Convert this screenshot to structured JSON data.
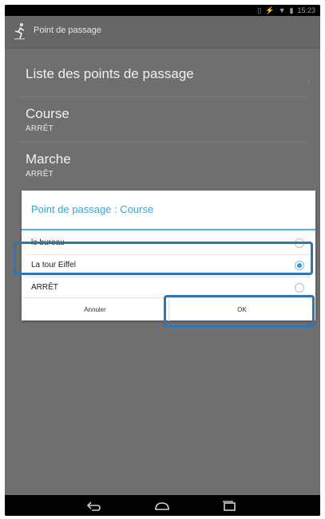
{
  "statusbar": {
    "time": "15:23",
    "icons": [
      "signal-icon",
      "wifi-icon",
      "battery-icon"
    ]
  },
  "actionbar": {
    "title": "Point de passage",
    "icon": "runner-icon"
  },
  "list": {
    "items": [
      {
        "label": "Liste des points de passage",
        "sub": ""
      },
      {
        "label": "Course",
        "sub": "ARRÊT"
      },
      {
        "label": "Marche",
        "sub": "ARRÊT"
      }
    ]
  },
  "dialog": {
    "title": "Point de passage : Course",
    "options": [
      {
        "label": "le bureau",
        "checked": false
      },
      {
        "label": "La tour Eiffel",
        "checked": true
      },
      {
        "label": "ARRÊT",
        "checked": false
      }
    ],
    "cancel_label": "Annuler",
    "ok_label": "OK"
  },
  "colors": {
    "accent": "#3aa3cf",
    "highlight": "#2f74b5",
    "dim_background": "#6f6f6f"
  }
}
